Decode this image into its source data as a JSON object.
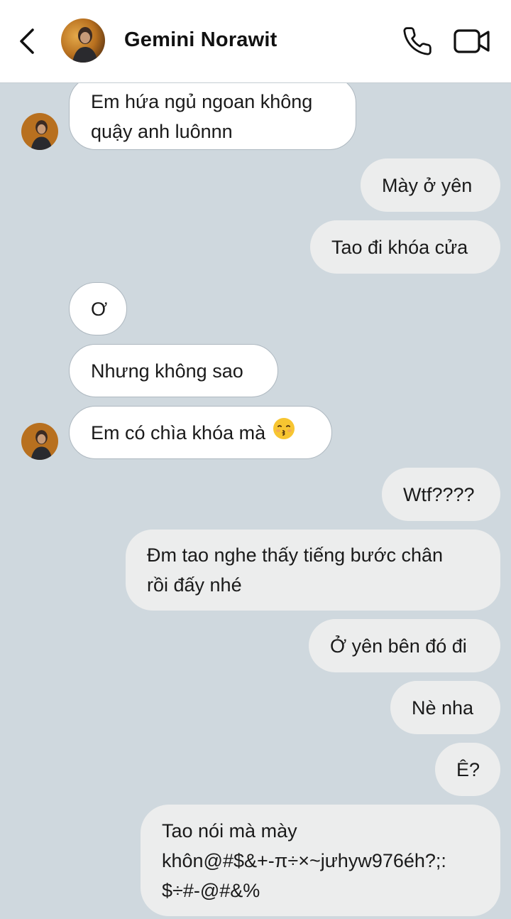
{
  "header": {
    "contact_name": "Gemini Norawit"
  },
  "icons": {
    "back": "chevron-left-icon",
    "call": "phone-icon",
    "video": "video-camera-icon",
    "emoji": "kissing-face-emoji"
  },
  "colors": {
    "chat_background": "#cfd8de",
    "incoming_bubble": "#ffffff",
    "outgoing_bubble": "#eceded",
    "header_background": "#ffffff"
  },
  "messages": [
    {
      "direction": "in",
      "lines": [
        "Em hứa ngủ ngoan không",
        "quậy anh luônnn"
      ]
    },
    {
      "direction": "out",
      "lines": [
        "Mày ở yên"
      ]
    },
    {
      "direction": "out",
      "lines": [
        "Tao đi khóa cửa"
      ]
    },
    {
      "direction": "in",
      "lines": [
        "Ơ"
      ]
    },
    {
      "direction": "in",
      "lines": [
        "Nhưng không sao"
      ]
    },
    {
      "direction": "in",
      "lines": [
        "Em có chìa khóa mà"
      ]
    },
    {
      "direction": "out",
      "lines": [
        "Wtf????"
      ]
    },
    {
      "direction": "out",
      "lines": [
        "Đm tao nghe thấy tiếng bước chân",
        "rồi đấy nhé"
      ]
    },
    {
      "direction": "out",
      "lines": [
        "Ở yên bên đó đi"
      ]
    },
    {
      "direction": "out",
      "lines": [
        "Nè nha"
      ]
    },
    {
      "direction": "out",
      "lines": [
        "Ê?"
      ]
    },
    {
      "direction": "out",
      "lines": [
        "Tao nói mà mày",
        "khôn@#$&+-π÷×~jưhyw976éh?;:",
        "$÷#-@#&%"
      ]
    }
  ]
}
